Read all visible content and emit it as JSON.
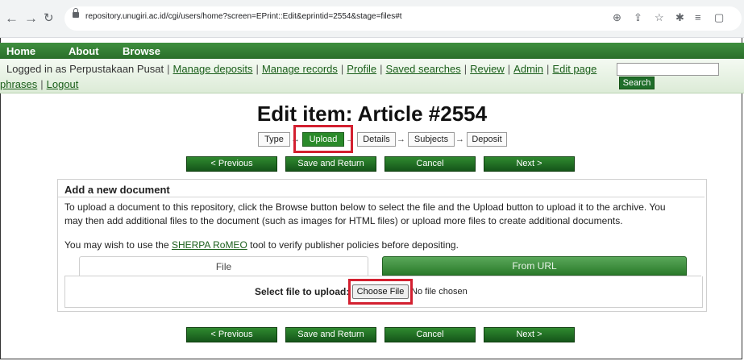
{
  "browser": {
    "url": "repository.unugiri.ac.id/cgi/users/home?screen=EPrint::Edit&eprintid=2554&stage=files#t",
    "back_icon": "arrow-left-icon",
    "forward_icon": "arrow-right-icon",
    "reload_icon": "reload-icon"
  },
  "menu": {
    "items": [
      "Home",
      "About",
      "Browse"
    ]
  },
  "login": {
    "prefix": "Logged in as Perpustakaan Pusat",
    "links_line1": [
      "Manage deposits",
      "Manage records",
      "Profile",
      "Saved searches",
      "Review",
      "Admin",
      "Edit page"
    ],
    "links_line2": [
      "phrases",
      "Logout"
    ],
    "search_button": "Search"
  },
  "page": {
    "title": "Edit item: Article #2554"
  },
  "workflow": {
    "steps": [
      "Type",
      "Upload",
      "Details",
      "Subjects",
      "Deposit"
    ],
    "active": "Upload"
  },
  "actions": {
    "previous": "< Previous",
    "save_return": "Save and Return",
    "cancel": "Cancel",
    "next": "Next >"
  },
  "panel": {
    "title": "Add a new document",
    "text_line1": "To upload a document to this repository, click the Browse button below to select the file and the Upload button to upload it to the archive. You",
    "text_line2": "may then add additional files to the document (such as images for HTML files) or upload more files to create additional documents.",
    "romeo_prefix": "You may wish to use the ",
    "romeo_link": "SHERPA RoMEO",
    "romeo_suffix": " tool to verify publisher policies before depositing.",
    "tabs": [
      "File",
      "From URL"
    ],
    "select_label": "Select file to upload:",
    "choose_file": "Choose File",
    "no_file": "No file chosen"
  },
  "colors": {
    "brand_green": "#2e7d32",
    "highlight_red": "#d32030"
  }
}
